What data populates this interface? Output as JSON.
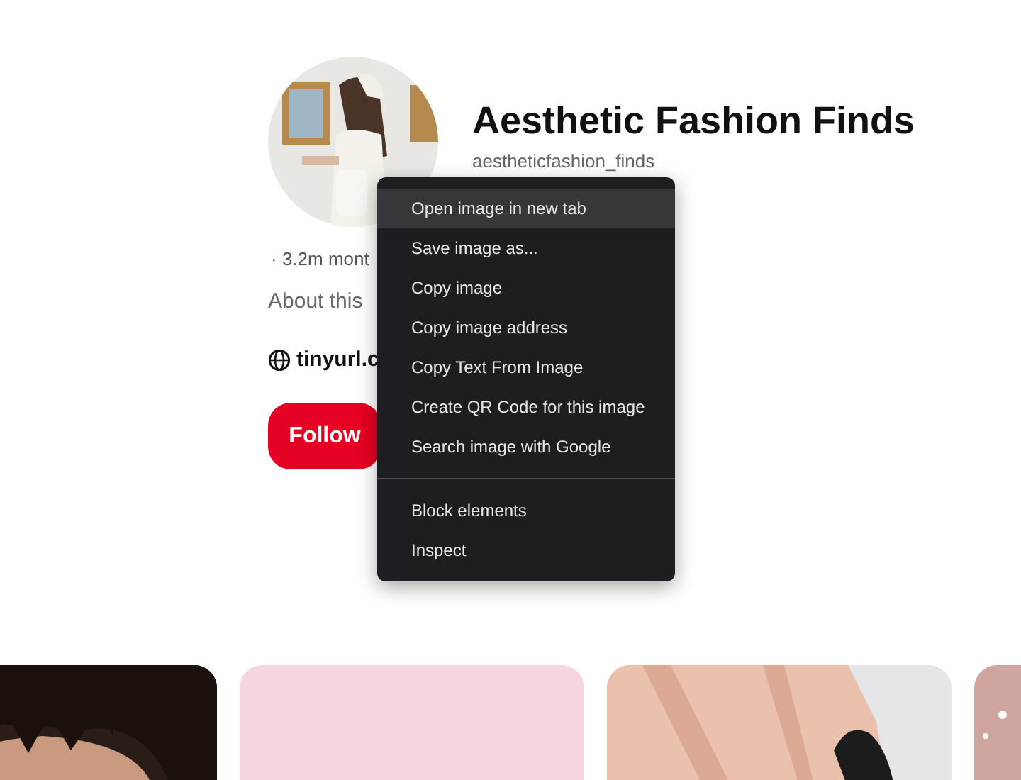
{
  "profile": {
    "name": "Aesthetic Fashion Finds",
    "handle": "aestheticfashion_finds",
    "stats": "· 3.2m mont",
    "about": "About this",
    "link": "tinyurl.c",
    "follow_button": "Follow"
  },
  "context_menu": {
    "groups": [
      [
        {
          "label": "Open image in new tab",
          "selected": true
        },
        {
          "label": "Save image as...",
          "selected": false
        },
        {
          "label": "Copy image",
          "selected": false
        },
        {
          "label": "Copy image address",
          "selected": false
        },
        {
          "label": "Copy Text From Image",
          "selected": false
        },
        {
          "label": "Create QR Code for this image",
          "selected": false
        },
        {
          "label": "Search image with Google",
          "selected": false
        }
      ],
      [
        {
          "label": "Block elements",
          "selected": false
        },
        {
          "label": "Inspect",
          "selected": false
        }
      ]
    ]
  },
  "pins": [
    {
      "kind": "picture"
    },
    {
      "kind": "blank"
    },
    {
      "kind": "picture"
    },
    {
      "kind": "picture"
    }
  ]
}
